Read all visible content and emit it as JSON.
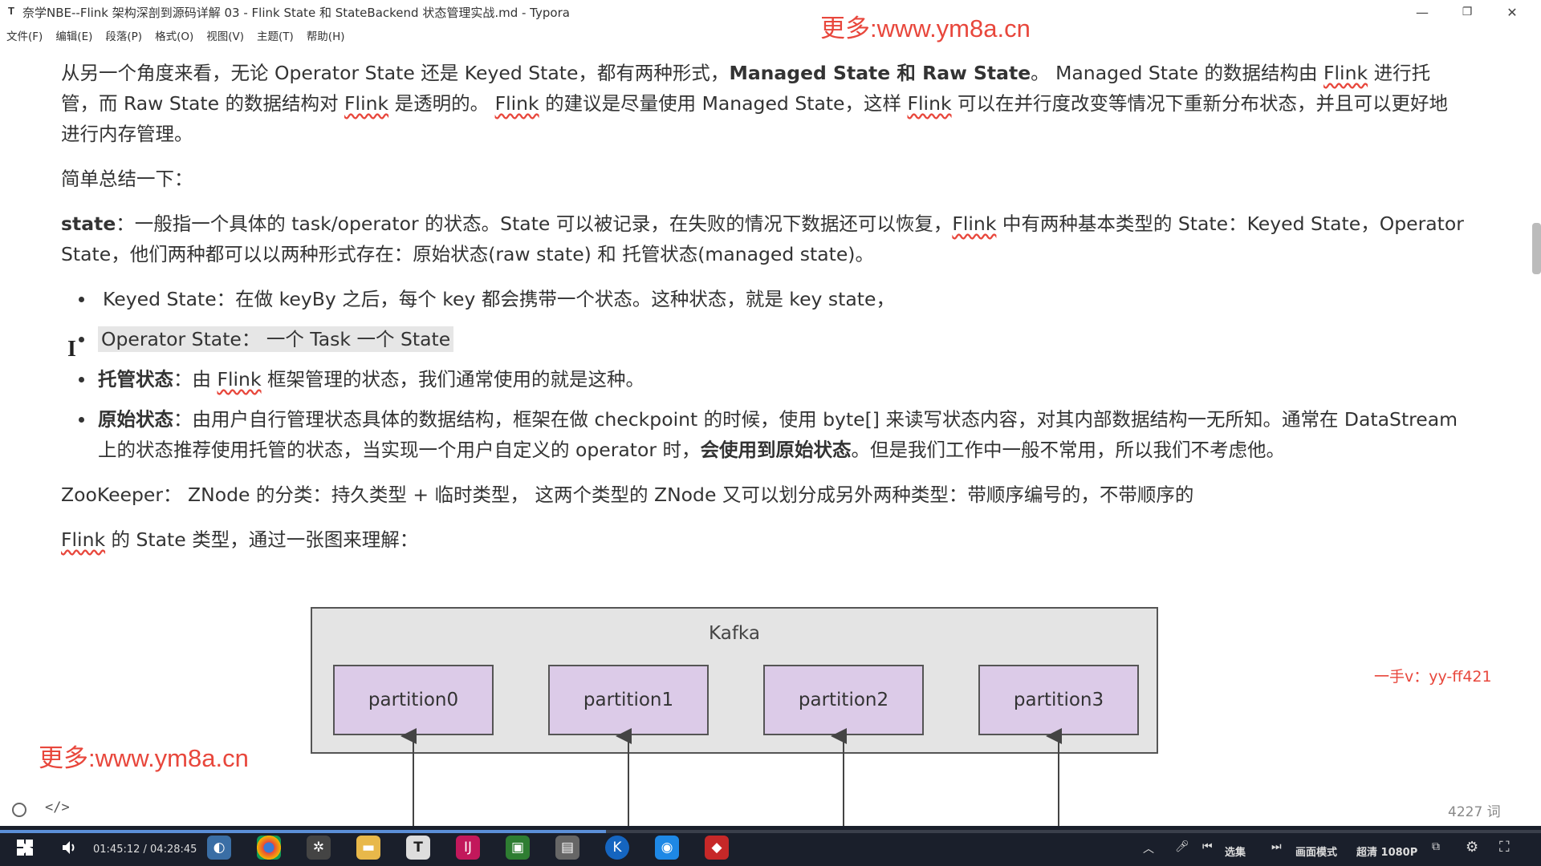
{
  "window": {
    "app_icon": "T",
    "title": "奈学NBE--Flink 架构深剖到源码详解 03 - Flink State 和 StateBackend 状态管理实战.md - Typora",
    "minimize": "—",
    "maximize": "❐",
    "close": "✕"
  },
  "watermark_top": "更多:www.ym8a.cn",
  "menu": [
    "文件(F)",
    "编辑(E)",
    "段落(P)",
    "格式(O)",
    "视图(V)",
    "主题(T)",
    "帮助(H)"
  ],
  "content": {
    "p1": {
      "a": "从另一个角度来看，无论 Operator State 还是 Keyed State，都有两种形式，",
      "b1": "Managed State",
      "c": " 和 ",
      "b2": "Raw State",
      "d": "。 Managed State 的数据结构由 ",
      "flink1": "Flink",
      "e": " 进行托管，而 Raw State 的数据结构对 ",
      "flink2": "Flink",
      "f": " 是透明的。 ",
      "flink3": "Flink",
      "g": " 的建议是尽量使用 Managed State，这样 ",
      "flink4": "Flink",
      "h": " 可以在并行度改变等情况下重新分布状态，并且可以更好地进行内存管理。"
    },
    "p2": "简单总结一下：",
    "p3": {
      "b": "state",
      "a": "：一般指一个具体的 task/operator 的状态。State 可以被记录，在失败的情况下数据还可以恢复，",
      "flink": "Flink",
      "c": " 中有两种基本类型的 State：Keyed State，Operator State，他们两种都可以以两种形式存在：原始状态(raw state) 和 托管状态(managed state)。"
    },
    "li1": "Keyed State：在做 keyBy 之后，每个 key 都会携带一个状态。这种状态，就是 key state，",
    "li2": "Operator State：  一个 Task 一个 State",
    "li3": {
      "b": "托管状态",
      "a": "：由 ",
      "flink": "Flink",
      "c": " 框架管理的状态，我们通常使用的就是这种。"
    },
    "li4": {
      "b": "原始状态",
      "a": "：由用户自行管理状态具体的数据结构，框架在做 checkpoint 的时候，使用 byte[] 来读写状态内容，对其内部数据结构一无所知。通常在 DataStream 上的状态推荐使用托管的状态，当实现一个用户自定义的 operator 时，",
      "b2": "会使用到原始状态",
      "c": "。但是我们工作中一般不常用，所以我们不考虑他。"
    },
    "p4": "ZooKeeper：  ZNode 的分类：持久类型 + 临时类型，  这两个类型的 ZNode 又可以划分成另外两种类型：带顺序编号的，不带顺序的",
    "p5": {
      "flink": "Flink",
      "a": " 的 State 类型，通过一张图来理解："
    }
  },
  "diagram": {
    "container": "Kafka",
    "partitions": [
      "partition0",
      "partition1",
      "partition2",
      "partition3"
    ]
  },
  "watermark_left": "更多:www.ym8a.cn",
  "watermark_right": "一手v：yy-ff421",
  "status": {
    "code_toggle": "</>",
    "word_count": "4227 词"
  },
  "player": {
    "time": "01:45:12 / 04:28:45",
    "progress": 0.393,
    "episodes": "选集",
    "picture_mode": "画面模式",
    "quality": "超清 1080P"
  },
  "icons": [
    "windows-start-icon",
    "play-icon",
    "volume-icon",
    "chrome-icon",
    "typora-icon",
    "intellij-icon",
    "files-icon",
    "settings-icon",
    "fullscreen-icon"
  ]
}
